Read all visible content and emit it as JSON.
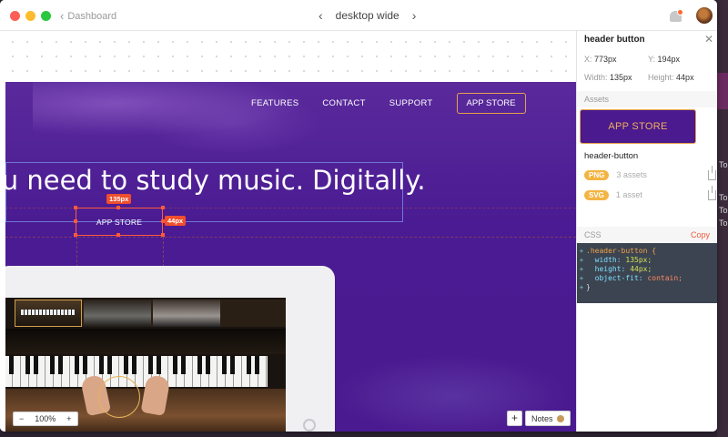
{
  "window": {
    "back_label": "Dashboard",
    "screen_title": "desktop wide"
  },
  "artboard": {
    "nav": [
      "FEATURES",
      "CONTACT",
      "SUPPORT"
    ],
    "app_store_label": "APP STORE",
    "headline": "ou need to study music. Digitally.",
    "selected_button_label": "APP STORE",
    "width_tag": "135px",
    "height_tag": "44px"
  },
  "canvas_controls": {
    "zoom_minus": "−",
    "zoom_value": "100%",
    "zoom_plus": "+",
    "add_label": "+",
    "notes_label": "Notes"
  },
  "inspector": {
    "title": "header button",
    "x_label": "X:",
    "x_value": "773px",
    "y_label": "Y:",
    "y_value": "194px",
    "width_label": "Width:",
    "width_value": "135px",
    "height_label": "Height:",
    "height_value": "44px",
    "assets_label": "Assets",
    "preview_label": "APP STORE",
    "asset_name": "header-button",
    "png_badge": "PNG",
    "png_count": "3 assets",
    "svg_badge": "SVG",
    "svg_count": "1 asset",
    "css_label": "CSS",
    "copy_label": "Copy",
    "code": {
      "selector": ".header-button {",
      "l1_prop": "width:",
      "l1_val": "135px;",
      "l2_prop": "height:",
      "l2_val": "44px;",
      "l3_prop": "object-fit:",
      "l3_val": "contain;",
      "close": "}"
    }
  },
  "desktop_fragments": [
    "To",
    "To",
    "To",
    "To"
  ],
  "colors": {
    "brand_purple": "#4a1a90",
    "accent_orange": "#e6a24a",
    "selection_red": "#ff5a3a",
    "badge_yellow": "#f4b443"
  }
}
